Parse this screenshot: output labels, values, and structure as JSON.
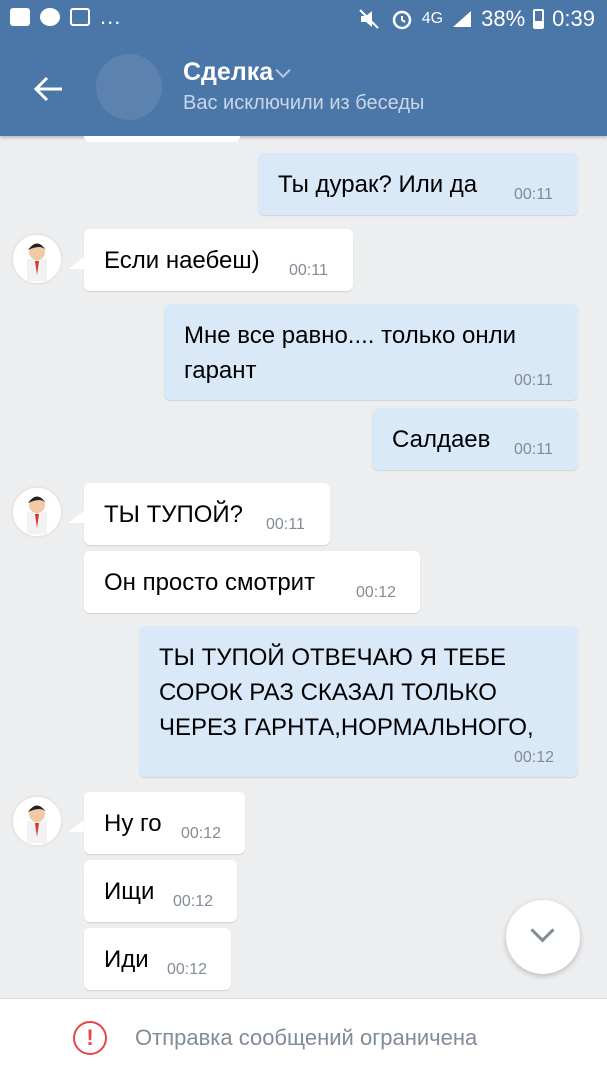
{
  "statusbar": {
    "network": "4G",
    "battery": "38%",
    "time": "0:39"
  },
  "header": {
    "title": "Сделка",
    "subtitle": "Вас исключили из беседы"
  },
  "messages": [
    {
      "dir": "out",
      "text": "Ты дурак? Или да",
      "time": "00:11"
    },
    {
      "dir": "in",
      "text": "Если наебеш)",
      "time": "00:11"
    },
    {
      "dir": "out",
      "lines": [
        "Мне все равно.... только онли",
        "гарант"
      ],
      "time": "00:11"
    },
    {
      "dir": "out",
      "text": "Салдаев",
      "time": "00:11"
    },
    {
      "dir": "in",
      "text": "ТЫ ТУПОЙ?",
      "time": "00:11"
    },
    {
      "dir": "in",
      "text": "Он просто смотрит",
      "time": "00:12"
    },
    {
      "dir": "out",
      "lines": [
        "ТЫ ТУПОЙ ОТВЕЧАЮ Я ТЕБЕ",
        "СОРОК РАЗ СКАЗАЛ ТОЛЬКО",
        "ЧЕРЕЗ ГАРНТА,НОРМАЛЬНОГО,"
      ],
      "time": "00:12"
    },
    {
      "dir": "in",
      "text": "Ну го",
      "time": "00:12"
    },
    {
      "dir": "in",
      "text": "Ищи",
      "time": "00:12"
    },
    {
      "dir": "in",
      "text": "Иди",
      "time": "00:12"
    }
  ],
  "footer": {
    "warning_icon": "!",
    "text": "Отправка сообщений ограничена"
  },
  "icons": {
    "back": "arrow-left-icon",
    "scroll_down": "chevron-down-icon",
    "warning": "exclamation-circle-icon"
  },
  "colors": {
    "header": "#4a76a8",
    "background": "#edeef0",
    "outgoing_bubble": "#dae9f8",
    "incoming_bubble": "#ffffff",
    "warning": "#e64646"
  }
}
